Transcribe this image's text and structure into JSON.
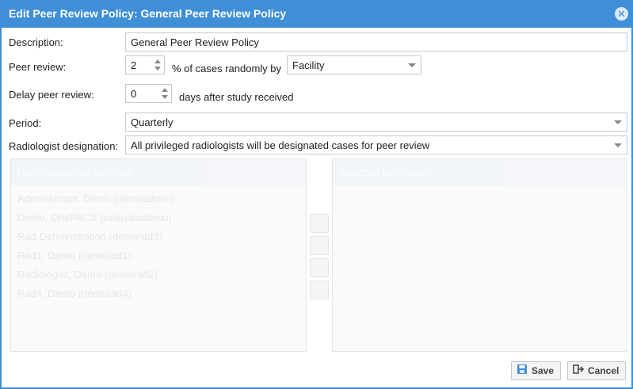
{
  "dialog": {
    "title": "Edit Peer Review Policy: General Peer Review Policy",
    "close_icon": "close-circle-icon"
  },
  "form": {
    "description": {
      "label": "Description:",
      "value": "General Peer Review Policy"
    },
    "peer_review": {
      "label": "Peer review:",
      "percent_value": "2",
      "mid_text": "% of cases randomly by",
      "by_value": "Facility"
    },
    "delay": {
      "label": "Delay peer review:",
      "value": "0",
      "suffix": "days after study received"
    },
    "period": {
      "label": "Period:",
      "value": "Quarterly"
    },
    "designation": {
      "label": "Radiologist designation:",
      "value": "All privileged radiologists will be designated cases for peer review"
    }
  },
  "lists": {
    "available": {
      "header": "Radiologists not selected",
      "items": [
        "Administrator, Demo (demoadmin)",
        "Demo, OnePACS (onepacsdemo)",
        "Rad Demonstration (demorad3)",
        "Rad1, Demo (demorad1)",
        "Radiologist, Demo (demorad2)",
        "Rad4, Demo (demorad4)"
      ]
    },
    "selected": {
      "header": "Selected radiologists",
      "items": []
    }
  },
  "footer": {
    "save_label": "Save",
    "cancel_label": "Cancel"
  },
  "colors": {
    "accent": "#3f8fd8",
    "border": "#c8c8c8"
  }
}
